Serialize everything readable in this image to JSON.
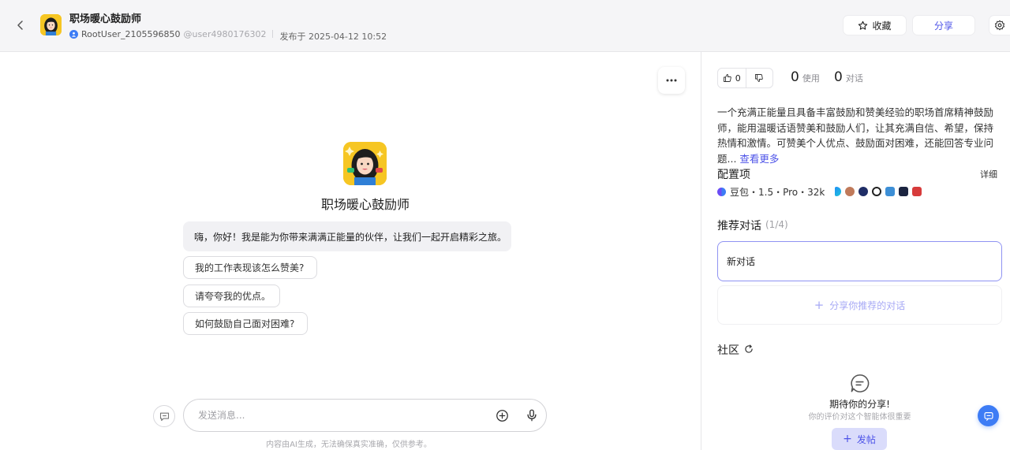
{
  "header": {
    "title": "职场暖心鼓励师",
    "author": "RootUser_2105596850",
    "user_id": "@user4980176302",
    "published": "发布于 2025-04-12 10:52",
    "favorite_label": "收藏",
    "share_label": "分享"
  },
  "chat": {
    "bot_name": "职场暖心鼓励师",
    "greeting": "嗨，你好！我是能为你带来满满正能量的伙伴，让我们一起开启精彩之旅。",
    "suggestions": [
      "我的工作表现该怎么赞美?",
      "请夸夸我的优点。",
      "如何鼓励自己面对困难?"
    ],
    "input_placeholder": "发送消息...",
    "disclaimer": "内容由AI生成，无法确保真实准确，仅供参考。"
  },
  "panel": {
    "likes": "0",
    "usage_count": "0",
    "usage_label": "使用",
    "chat_count": "0",
    "chat_label": "对话",
    "description": "一个充满正能量且具备丰富鼓励和赞美经验的职场首席精神鼓励师，能用温暖话语赞美和鼓励人们，让其充满自信、希望，保持热情和激情。可赞美个人优点、鼓励面对困难，还能回答专业问题...",
    "see_more": "查看更多",
    "config_title": "配置项",
    "config_detail": "详细",
    "model": "豆包・1.5・Pro・32k",
    "recommend_title": "推荐对话",
    "recommend_count": "(1/4)",
    "new_chat": "新对话",
    "share_recommend": "分享你推荐的对话",
    "community_title": "社区",
    "empty_title": "期待你的分享!",
    "empty_sub": "你的评价对这个智能体很重要",
    "post_label": "发帖"
  },
  "colors": {
    "accent": "#4d53e8",
    "avatar_bg": "#f6c623",
    "header_bg": "#f5f5f7"
  }
}
